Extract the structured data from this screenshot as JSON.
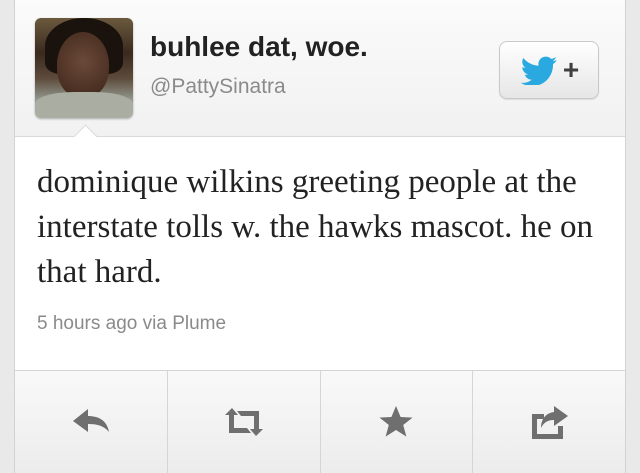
{
  "user": {
    "display_name": "buhlee dat, woe.",
    "handle": "@PattySinatra"
  },
  "follow_button": {
    "icon": "twitter-bird-icon",
    "plus_label": "+",
    "accent": "#2aa9e0"
  },
  "tweet": {
    "text": "dominique wilkins greeting people at the interstate tolls w. the hawks mascot. he on that hard.",
    "meta": "5 hours ago via Plume"
  },
  "actions": [
    {
      "name": "reply",
      "icon": "reply-arrow-icon"
    },
    {
      "name": "retweet",
      "icon": "retweet-icon"
    },
    {
      "name": "favorite",
      "icon": "star-icon"
    },
    {
      "name": "share",
      "icon": "share-icon"
    }
  ],
  "colors": {
    "icon_gray": "#6f6f6f",
    "text": "#222222",
    "secondary_text": "#8a8a8a"
  }
}
